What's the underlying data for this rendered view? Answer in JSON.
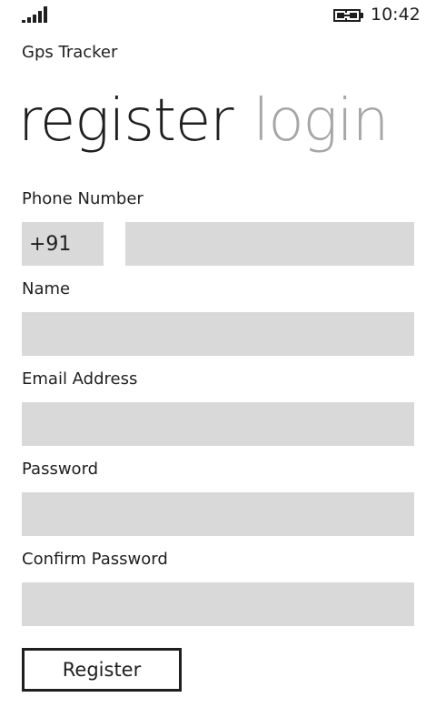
{
  "status_bar": {
    "signal_icon": "signal-strength-icon",
    "battery_icon": "battery-charging-icon",
    "time": "10:42"
  },
  "app": {
    "title": "Gps Tracker"
  },
  "pivot": {
    "active": "register",
    "inactive": "login"
  },
  "form": {
    "phone_label": "Phone Number",
    "country_code": "+91",
    "phone_value": "",
    "name_label": "Name",
    "name_value": "",
    "email_label": "Email Address",
    "email_value": "",
    "password_label": "Password",
    "password_value": "",
    "confirm_label": "Confirm Password",
    "confirm_value": "",
    "register_button": "Register"
  },
  "colors": {
    "text": "#1f1f1f",
    "inactive_pivot": "#a6a6a6",
    "field_background": "#d9d9d9",
    "background": "#ffffff"
  }
}
